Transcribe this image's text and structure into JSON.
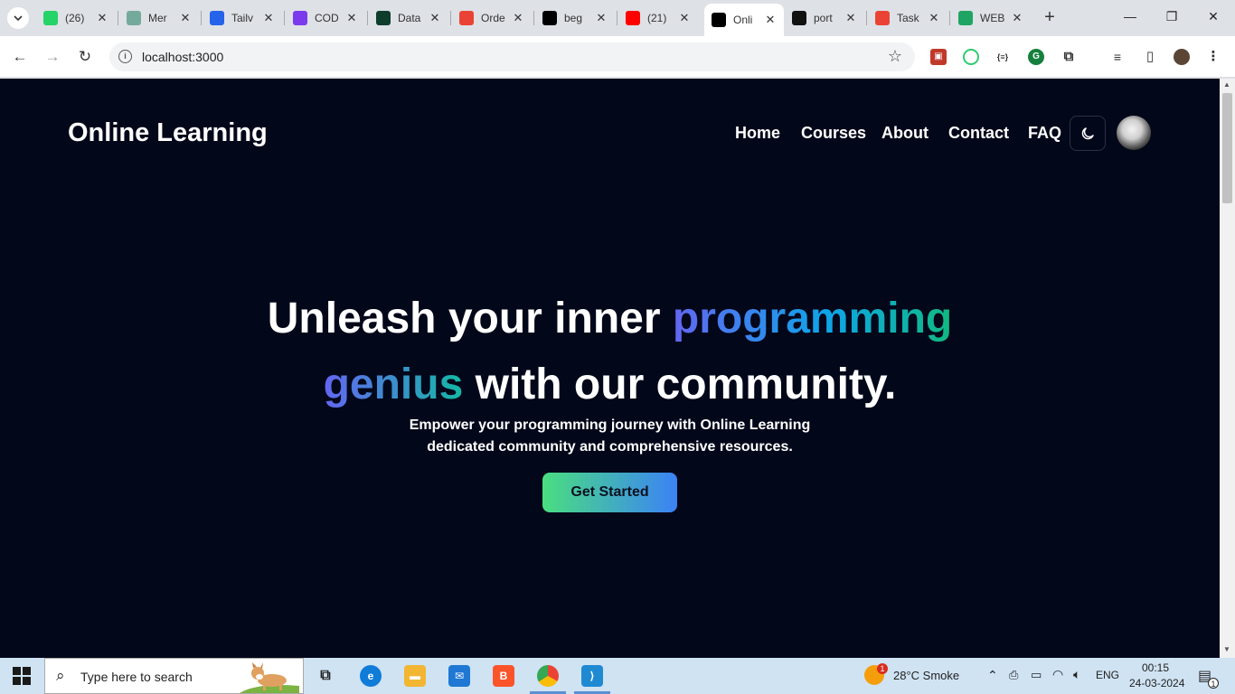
{
  "browser": {
    "tabs": [
      {
        "title": "(26)",
        "icon": "whatsapp-icon",
        "color": "#25d366"
      },
      {
        "title": "Mer",
        "icon": "chatgpt-icon",
        "color": "#74aa9c"
      },
      {
        "title": "Tailv",
        "icon": "video-play-icon",
        "color": "#2563eb"
      },
      {
        "title": "COD",
        "icon": "list-icon",
        "color": "#7c3aed"
      },
      {
        "title": "Data",
        "icon": "mongodb-leaf-icon",
        "color": "#0f3d2b"
      },
      {
        "title": "Orde",
        "icon": "gmail-icon",
        "color": "#ea4335"
      },
      {
        "title": "beg",
        "icon": "nextjs-triangle-icon",
        "color": "#000000"
      },
      {
        "title": "(21)",
        "icon": "youtube-icon",
        "color": "#ff0000"
      },
      {
        "title": "Onli",
        "icon": "nextjs-triangle-icon",
        "color": "#000000"
      },
      {
        "title": "port",
        "icon": "github-icon",
        "color": "#111111"
      },
      {
        "title": "Task",
        "icon": "gmail-icon",
        "color": "#ea4335"
      },
      {
        "title": "WEB",
        "icon": "google-drive-icon",
        "color": "#1fa463"
      }
    ],
    "active_tab": 8,
    "url": "localhost:3000"
  },
  "site": {
    "logo": "Online Learning",
    "nav": [
      "Home",
      "Courses",
      "About",
      "Contact",
      "FAQ"
    ],
    "hero": {
      "line1_plain": "Unleash your inner ",
      "line1_highlight": "programming",
      "line2_highlight": "genius",
      "line2_plain": " with our community.",
      "sub_line1": "Empower your programming journey with Online Learning",
      "sub_line2": "dedicated community and comprehensive resources.",
      "cta": "Get Started"
    },
    "colors": {
      "background": "#03071a",
      "gradient_start": "#6366f1",
      "gradient_end": "#10b981",
      "cta_start": "#4ade80",
      "cta_end": "#3b82f6"
    }
  },
  "taskbar": {
    "search_placeholder": "Type here to search",
    "weather": "28°C  Smoke",
    "weather_badge": "1",
    "language": "ENG",
    "time": "00:15",
    "date": "24-03-2024",
    "notification_count": "1"
  }
}
